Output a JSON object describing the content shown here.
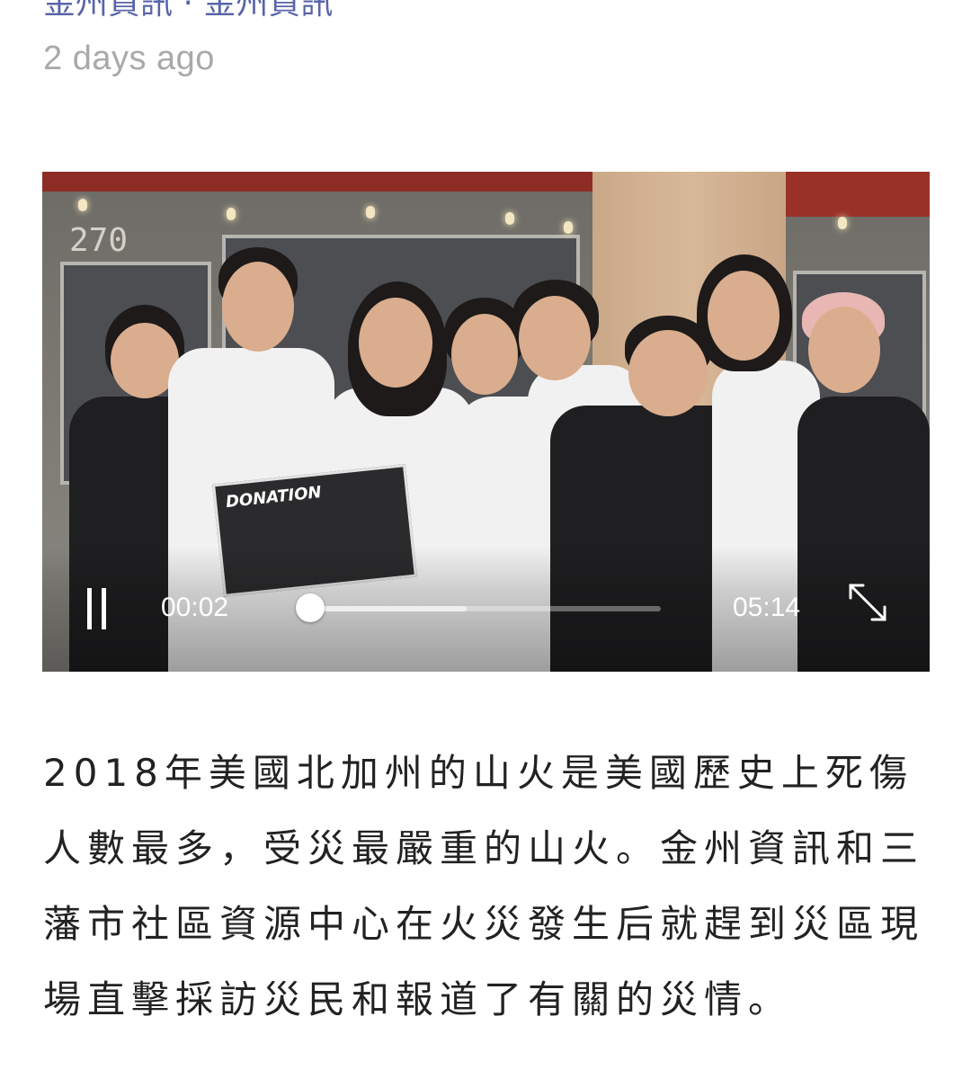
{
  "header": {
    "link_text_partial": "金州資訊 · 金州資訊",
    "timestamp": "2 days ago"
  },
  "video": {
    "current_time": "00:02",
    "total_time": "05:14",
    "progress_fraction": 0.006,
    "buffered_fraction": 0.45,
    "state": "playing",
    "pause_icon": "pause-icon",
    "fullscreen_icon": "fullscreen-icon",
    "scene_sign_text": "270",
    "box_text": "DONATION"
  },
  "article": {
    "text": "2018年美國北加州的山火是美國歷史上死傷人數最多，受災最嚴重的山火。金州資訊和三藩市社區資源中心在火災發生后就趕到災區現場直擊採訪災民和報道了有關的災情。"
  },
  "colors": {
    "timestamp": "#a9a9a9",
    "link": "#3b4a9a",
    "article_text": "#222222"
  }
}
